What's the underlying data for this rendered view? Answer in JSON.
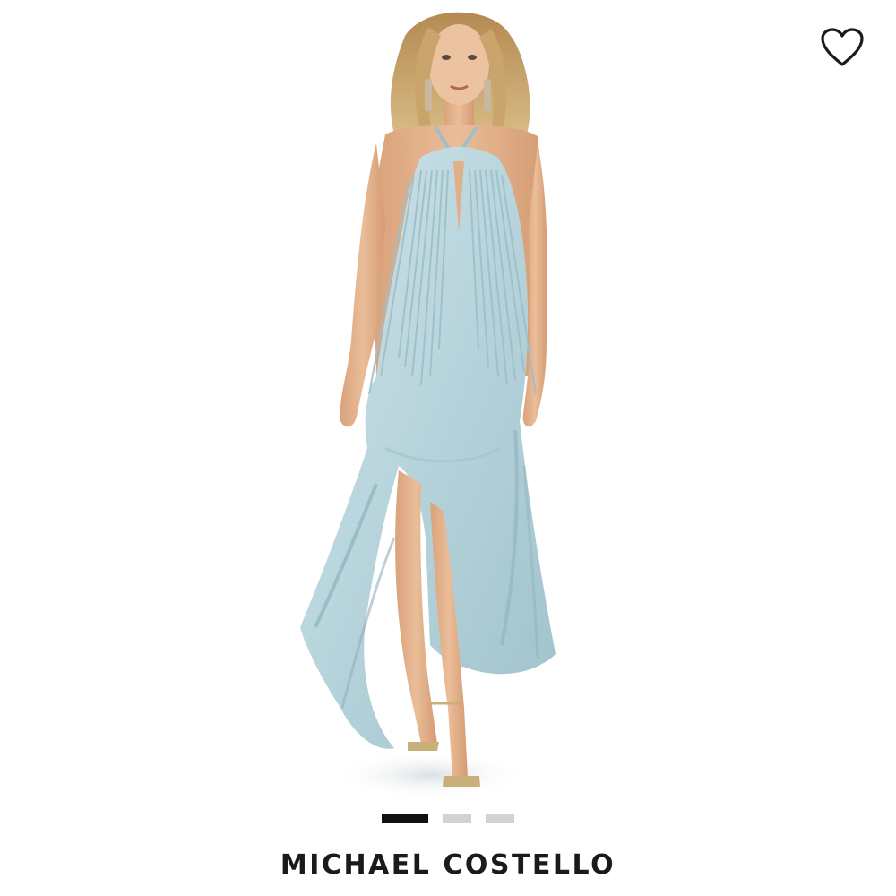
{
  "product": {
    "brand": "MICHAEL COSTELLO",
    "image_description_icon": "model-wearing-dress-photo"
  },
  "wishlist": {
    "icon": "heart-outline-icon"
  },
  "carousel": {
    "total": 3,
    "active_index": 0
  },
  "colors": {
    "dress": "#b9d6dd",
    "dress_shadow": "#8fb3bc",
    "skin": "#e6b48f",
    "hair": "#c9a56c",
    "active_dot": "#111111",
    "inactive_dot": "#d2d2d2",
    "brand_text": "#1a1a1a"
  }
}
